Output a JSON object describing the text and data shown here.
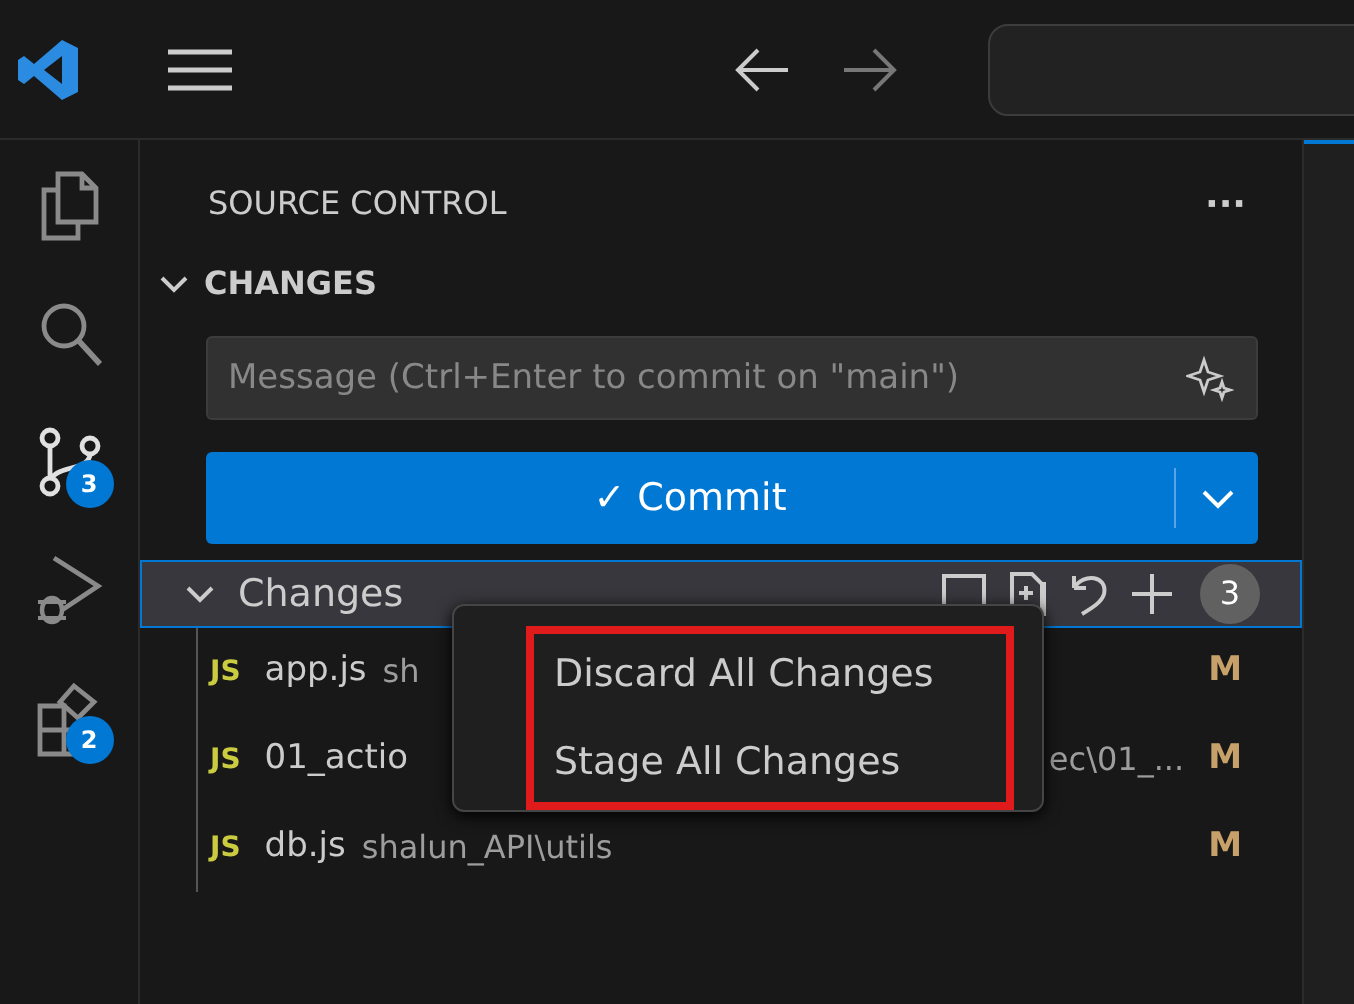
{
  "activity_bar": [
    {
      "kind": "explorer",
      "selected": false
    },
    {
      "kind": "search",
      "selected": false
    },
    {
      "kind": "source_control",
      "selected": true,
      "badge": "3"
    },
    {
      "kind": "debug",
      "selected": false
    },
    {
      "kind": "extensions",
      "selected": false,
      "badge": "2"
    }
  ],
  "sidebar": {
    "title": "SOURCE CONTROL",
    "more": "···",
    "section": {
      "label": "CHANGES",
      "expanded": true
    },
    "message": {
      "placeholder": "Message (Ctrl+Enter to commit on \"main\")"
    },
    "commit_button": "✓ Commit",
    "changes_group": {
      "label": "Changes",
      "expanded": true,
      "selected": true,
      "count": "3"
    },
    "files": [
      {
        "kind": "plain",
        "icon": "JS",
        "name": "app.js",
        "description": "sh",
        "status": "M"
      },
      {
        "kind": "trailing",
        "icon": "JS",
        "name": "01_actio",
        "description": "ec\\01_...",
        "status": "M"
      },
      {
        "kind": "plain",
        "icon": "JS",
        "name": "db.js",
        "description": "shalun_API\\utils",
        "status": "M"
      }
    ]
  },
  "context_menu": {
    "highlight": true,
    "items": [
      "Discard All Changes",
      "Stage All Changes"
    ]
  }
}
